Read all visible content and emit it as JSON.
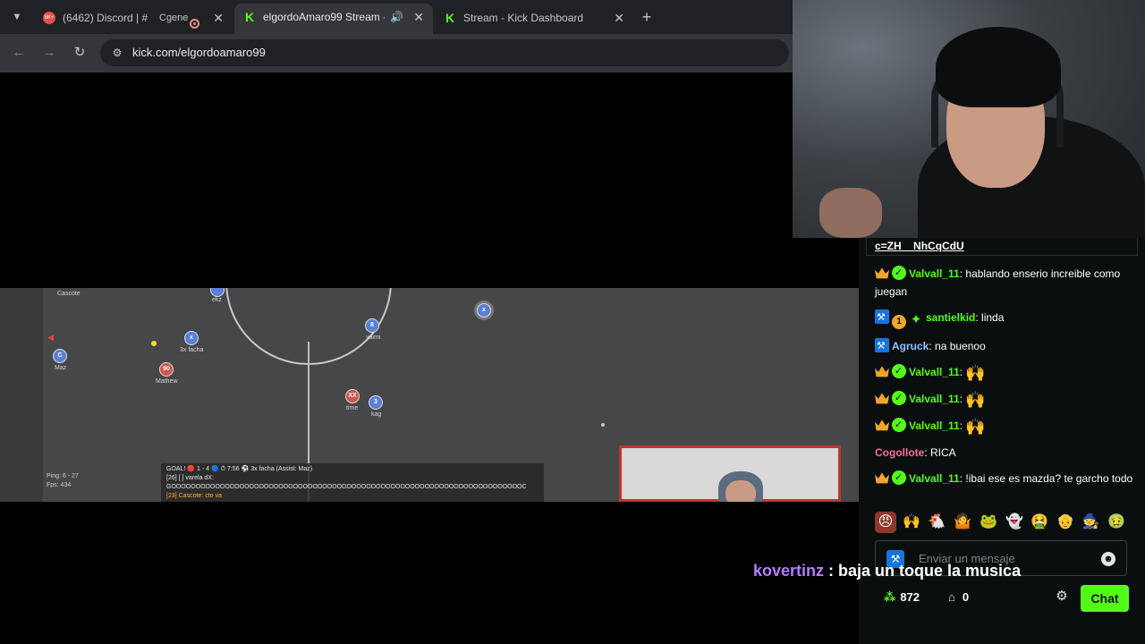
{
  "browser": {
    "tabs": [
      {
        "title": "(6462) Discord | #",
        "suffix": "Cgene",
        "favicon_text": "6K+"
      },
      {
        "title": "elgordoAmaro99 Stream - ",
        "active": true
      },
      {
        "title": "Stream - Kick Dashboard"
      }
    ],
    "url": "kick.com/elgordoamaro99"
  },
  "game": {
    "players": [
      {
        "label": "",
        "name": "Cascote",
        "team": "red"
      },
      {
        "label": "",
        "name": "ekz",
        "team": "blue"
      },
      {
        "label": "C",
        "name": "Maz",
        "team": "blue"
      },
      {
        "label": "x",
        "name": "3x facha",
        "team": "blue"
      },
      {
        "label": "90",
        "name": "Mathew",
        "team": "red"
      },
      {
        "label": "8",
        "name": "yaimi",
        "team": "blue"
      },
      {
        "label": "XX",
        "name": "time",
        "team": "red"
      },
      {
        "label": "3",
        "name": "kag",
        "team": "blue"
      },
      {
        "label": "x",
        "name": "",
        "team": "blue"
      }
    ],
    "stats": [
      "Ping: 6 - 27",
      "Fps: 434"
    ],
    "chat_lines": [
      "GOAL! 🔴 1 - 4 🔵  ⏱ 7:56  ⚽ 3x facha (Assist: Maz)",
      "[26] [ ] varela dX:",
      "GOOOOOOOOOOOOOOOOOOOOOOOOOOOOOOOOOOOOOOOOOOOOOOOOOOOOOOOOOOOOOOOOOOOOOOOOC",
      "[23] Cascote: cto va"
    ]
  },
  "chat": {
    "pinned": "c=ZH__NhCqCdU",
    "messages": [
      {
        "badges": [
          "crown",
          "verified"
        ],
        "user": "Valvall_11",
        "user_color": "green",
        "text": "hablando enserio increible como juegan"
      },
      {
        "badges": [
          "hammer",
          "sub1",
          "sparkle"
        ],
        "user": "santielkid",
        "user_color": "green",
        "text": "linda"
      },
      {
        "badges": [
          "hammer"
        ],
        "user": "Agruck",
        "user_color": "blue",
        "text": "na buenoo"
      },
      {
        "badges": [
          "crown",
          "verified"
        ],
        "user": "Valvall_11",
        "user_color": "green",
        "text": "",
        "emote": "🙌"
      },
      {
        "badges": [
          "crown",
          "verified"
        ],
        "user": "Valvall_11",
        "user_color": "green",
        "text": "",
        "emote": "🙌"
      },
      {
        "badges": [
          "crown",
          "verified"
        ],
        "user": "Valvall_11",
        "user_color": "green",
        "text": "",
        "emote": "🙌"
      },
      {
        "badges": [],
        "user": "Cogollote",
        "user_color": "pink",
        "text": "RICA"
      },
      {
        "badges": [
          "crown",
          "verified"
        ],
        "user": "Valvall_11",
        "user_color": "green",
        "text": "!ibai ese es mazda? te garcho todo"
      }
    ],
    "emote_bar": [
      "😠",
      "🙌",
      "🐔",
      "🤷",
      "🐸",
      "👻",
      "🤮",
      "👴",
      "🧙",
      "🤢"
    ],
    "input_placeholder": "Enviar un mensaje",
    "points": "872",
    "store_count": "0",
    "chat_button": "Chat",
    "sub1_label": "1"
  },
  "caption": {
    "user": "kovertinz",
    "text": " : baja un toque la musica"
  },
  "colors": {
    "kick_green": "#53fc18",
    "chat_bg": "#0b0e0f",
    "caption_user": "#b57cff"
  }
}
